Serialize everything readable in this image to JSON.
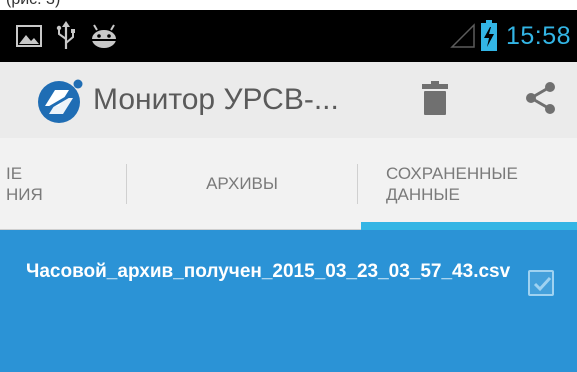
{
  "top_fragment": {
    "text": "(рис. 3)"
  },
  "status_bar": {
    "time": "15:58",
    "icons": [
      "gallery-icon",
      "usb-icon",
      "android-debug-icon",
      "signal-icon",
      "battery-icon"
    ]
  },
  "action_bar": {
    "title": "Монитор УРСВ-...",
    "actions": [
      {
        "icon": "trash-icon"
      },
      {
        "icon": "share-icon"
      }
    ]
  },
  "tabs": [
    {
      "label": "ТЕКУЩИЕ ЗНАЧЕНИЯ",
      "line1": "ІЕ",
      "line2": "НИЯ",
      "selected": false
    },
    {
      "label": "АРХИВЫ",
      "selected": false
    },
    {
      "label": "СОХРАНЕННЫЕ ДАННЫЕ",
      "line1": "СОХРАНЕННЫЕ",
      "line2": "ДАННЫЕ",
      "selected": true
    }
  ],
  "files": [
    {
      "name": "Часовой_архив_получен_2015_03_23_03_57_43.csv",
      "checked": true
    }
  ],
  "colors": {
    "accent": "#33b5e5",
    "selected_bg": "#2b93d6",
    "actionbar_bg": "#ebebeb",
    "statusbar_bg": "#000000"
  }
}
